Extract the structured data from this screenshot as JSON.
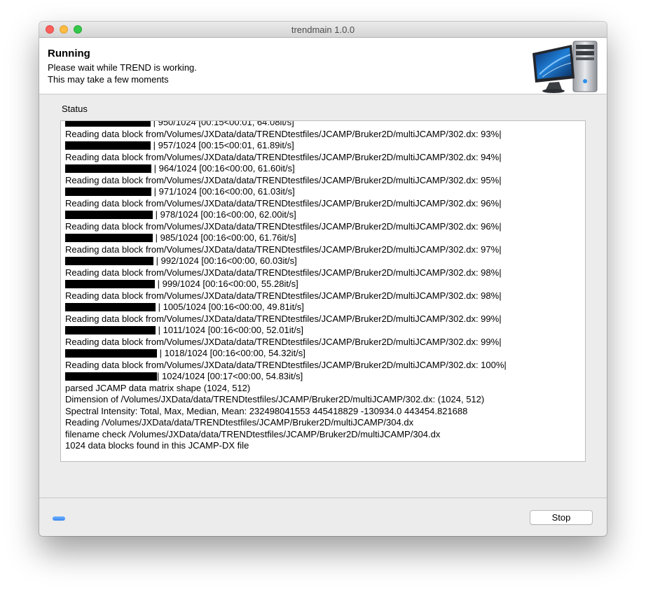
{
  "window": {
    "title": "trendmain 1.0.0"
  },
  "header": {
    "title": "Running",
    "line1": "Please wait while TREND is working.",
    "line2": "This may take a few moments"
  },
  "status_label": "Status",
  "log": [
    {
      "bar": 0.6777,
      "text": " | 950/1024 [00:15<00:01, 64.08it/s]"
    },
    {
      "text": "Reading data block from/Volumes/JXData/data/TRENDtestfiles/JCAMP/Bruker2D/multiJCAMP/302.dx:  93%|"
    },
    {
      "bar": 0.6777,
      "text": " | 957/1024 [00:15<00:01, 61.89it/s]"
    },
    {
      "text": "Reading data block from/Volumes/JXData/data/TRENDtestfiles/JCAMP/Bruker2D/multiJCAMP/302.dx:  94%|"
    },
    {
      "bar": 0.686,
      "text": " | 964/1024 [00:16<00:00, 61.60it/s]"
    },
    {
      "text": "Reading data block from/Volumes/JXData/data/TRENDtestfiles/JCAMP/Bruker2D/multiJCAMP/302.dx:  95%|"
    },
    {
      "bar": 0.686,
      "text": " | 971/1024 [00:16<00:00, 61.03it/s]"
    },
    {
      "text": "Reading data block from/Volumes/JXData/data/TRENDtestfiles/JCAMP/Bruker2D/multiJCAMP/302.dx:  96%|"
    },
    {
      "bar": 0.6942,
      "text": " | 978/1024 [00:16<00:00, 62.00it/s]"
    },
    {
      "text": "Reading data block from/Volumes/JXData/data/TRENDtestfiles/JCAMP/Bruker2D/multiJCAMP/302.dx:  96%|"
    },
    {
      "bar": 0.6942,
      "text": " | 985/1024 [00:16<00:00, 61.76it/s]"
    },
    {
      "text": "Reading data block from/Volumes/JXData/data/TRENDtestfiles/JCAMP/Bruker2D/multiJCAMP/302.dx:  97%|"
    },
    {
      "bar": 0.7025,
      "text": " | 992/1024 [00:16<00:00, 60.03it/s]"
    },
    {
      "text": "Reading data block from/Volumes/JXData/data/TRENDtestfiles/JCAMP/Bruker2D/multiJCAMP/302.dx:  98%|"
    },
    {
      "bar": 0.7107,
      "text": " | 999/1024 [00:16<00:00, 55.28it/s]"
    },
    {
      "text": "Reading data block from/Volumes/JXData/data/TRENDtestfiles/JCAMP/Bruker2D/multiJCAMP/302.dx:  98%|"
    },
    {
      "bar": 0.719,
      "text": " | 1005/1024 [00:16<00:00, 49.81it/s]"
    },
    {
      "text": "Reading data block from/Volumes/JXData/data/TRENDtestfiles/JCAMP/Bruker2D/multiJCAMP/302.dx:  99%|"
    },
    {
      "bar": 0.719,
      "text": " | 1011/1024 [00:16<00:00, 52.01it/s]"
    },
    {
      "text": "Reading data block from/Volumes/JXData/data/TRENDtestfiles/JCAMP/Bruker2D/multiJCAMP/302.dx:  99%|"
    },
    {
      "bar": 0.7273,
      "text": " | 1018/1024 [00:16<00:00, 54.32it/s]"
    },
    {
      "text": "Reading data block from/Volumes/JXData/data/TRENDtestfiles/JCAMP/Bruker2D/multiJCAMP/302.dx: 100%|"
    },
    {
      "bar": 0.7273,
      "text": "| 1024/1024 [00:17<00:00, 54.83it/s]"
    },
    {
      "text": "parsed JCAMP data matrix shape (1024, 512)"
    },
    {
      "text": "Dimension of /Volumes/JXData/data/TRENDtestfiles/JCAMP/Bruker2D/multiJCAMP/302.dx: (1024, 512)"
    },
    {
      "text": "Spectral Intensity: Total, Max, Median, Mean: 232498041553 445418829 -130934.0 443454.821688"
    },
    {
      "text": "Reading  /Volumes/JXData/data/TRENDtestfiles/JCAMP/Bruker2D/multiJCAMP/304.dx"
    },
    {
      "text": "filename check /Volumes/JXData/data/TRENDtestfiles/JCAMP/Bruker2D/multiJCAMP/304.dx"
    },
    {
      "text": "1024 data blocks found in this JCAMP-DX file"
    }
  ],
  "stop_label": "Stop",
  "colors": {
    "close": "#fc605b",
    "minimize": "#fdbc40",
    "maximize": "#34c84a",
    "spinner": "#3b88f0",
    "progress_bar": "#000000"
  }
}
